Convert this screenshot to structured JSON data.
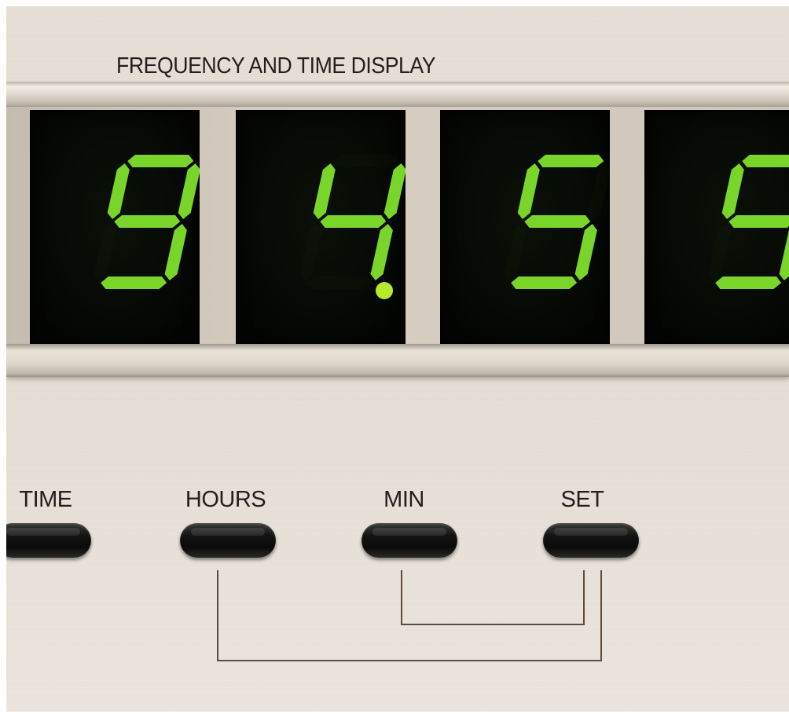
{
  "display": {
    "title": "FREQUENCY AND TIME DISPLAY",
    "digits": [
      "9",
      "4",
      "5",
      "5"
    ],
    "decimal_after_digit_index": 1,
    "segment_color": "#79d52a",
    "window_color": "#050704"
  },
  "buttons": [
    {
      "label": "TIME"
    },
    {
      "label": "HOURS"
    },
    {
      "label": "MIN"
    },
    {
      "label": "SET"
    }
  ],
  "colors": {
    "panel": "#e4ddd3",
    "label_text": "#221f1c",
    "bracket_line": "#5d4a3a",
    "button": "#0f0f0f"
  }
}
